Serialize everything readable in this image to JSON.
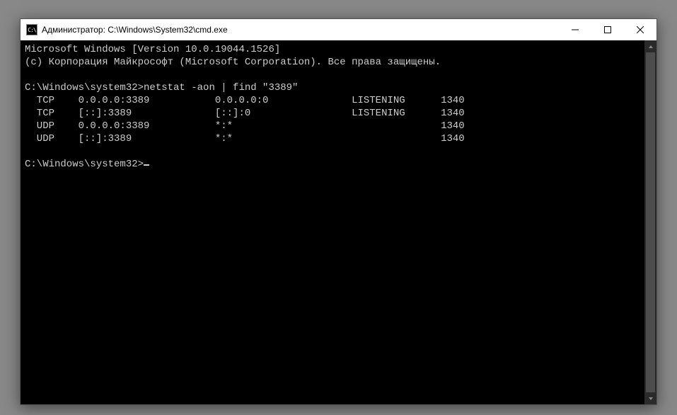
{
  "window": {
    "title": "Администратор: C:\\Windows\\System32\\cmd.exe",
    "icon_label": "C:\\"
  },
  "terminal": {
    "banner_line1": "Microsoft Windows [Version 10.0.19044.1526]",
    "banner_line2": "(c) Корпорация Майкрософт (Microsoft Corporation). Все права защищены.",
    "prompt1_path": "C:\\Windows\\system32>",
    "command": "netstat -aon | find \"3389\"",
    "rows": [
      {
        "proto": "TCP",
        "local": "0.0.0.0:3389",
        "foreign": "0.0.0.0:0",
        "state": "LISTENING",
        "pid": "1340"
      },
      {
        "proto": "TCP",
        "local": "[::]:3389",
        "foreign": "[::]:0",
        "state": "LISTENING",
        "pid": "1340"
      },
      {
        "proto": "UDP",
        "local": "0.0.0.0:3389",
        "foreign": "*:*",
        "state": "",
        "pid": "1340"
      },
      {
        "proto": "UDP",
        "local": "[::]:3389",
        "foreign": "*:*",
        "state": "",
        "pid": "1340"
      }
    ],
    "prompt2_path": "C:\\Windows\\system32>"
  }
}
